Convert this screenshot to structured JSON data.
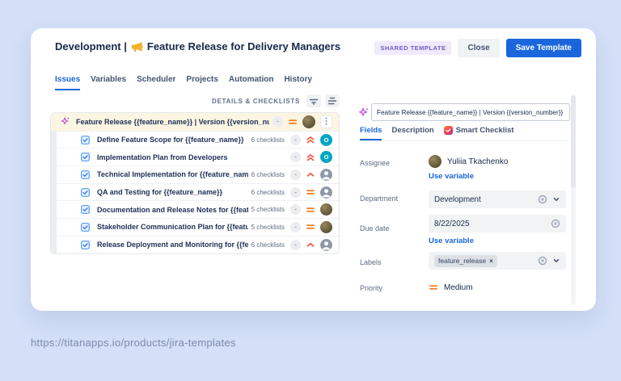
{
  "caption": "https://titanapps.io/products/jira-templates",
  "colors": {
    "background": "#D3E0F8",
    "accent_blue": "#1A66DC",
    "priority_medium_orange": "#F0832B",
    "priority_high_red": "#EF5C48",
    "sparkle_purple": "#BC52DE",
    "avatar_teal": "#00A6C0",
    "parent_row_cream": "#FBF5E2"
  },
  "header": {
    "title_prefix": "Development |",
    "title_main": "Feature Release for Delivery Managers",
    "shared_badge": "SHARED TEMPLATE",
    "close_button": "Close",
    "save_button": "Save Template"
  },
  "nav_tabs": [
    {
      "label": "Issues",
      "active": true
    },
    {
      "label": "Variables",
      "active": false
    },
    {
      "label": "Scheduler",
      "active": false
    },
    {
      "label": "Projects",
      "active": false
    },
    {
      "label": "Automation",
      "active": false
    },
    {
      "label": "History",
      "active": false
    }
  ],
  "left_panel": {
    "header_label": "DETAILS & CHECKLISTS",
    "rows": [
      {
        "type": "parent",
        "title": "Feature Release {{feature_name}} | Version {{version_nu...",
        "checklists": "",
        "estimate": "-",
        "priority": "medium",
        "avatar": "photo",
        "has_menu": true
      },
      {
        "type": "task",
        "title": "Define Feature Scope for {{feature_name}}",
        "checklists": "6 checklists",
        "estimate": "-",
        "priority": "highest",
        "avatar": "O",
        "has_menu": false
      },
      {
        "type": "task",
        "title": "Implementation Plan from Developers",
        "checklists": "",
        "estimate": "-",
        "priority": "highest",
        "avatar": "O",
        "has_menu": false
      },
      {
        "type": "task",
        "title": "Technical Implementation for {{feature_nam...",
        "checklists": "6 checklists",
        "estimate": "-",
        "priority": "high",
        "avatar": "person",
        "has_menu": false
      },
      {
        "type": "task",
        "title": "QA and Testing for {{feature_name}}",
        "checklists": "6 checklists",
        "estimate": "-",
        "priority": "medium",
        "avatar": "person",
        "has_menu": false
      },
      {
        "type": "task",
        "title": "Documentation and Release Notes for {{feat...",
        "checklists": "5 checklists",
        "estimate": "-",
        "priority": "medium",
        "avatar": "photo",
        "has_menu": false
      },
      {
        "type": "task",
        "title": "Stakeholder Communication Plan for {{featu...",
        "checklists": "5 checklists",
        "estimate": "-",
        "priority": "medium",
        "avatar": "photo",
        "has_menu": false
      },
      {
        "type": "task",
        "title": "Release Deployment and Monitoring for {{fe...",
        "checklists": "6 checklists",
        "estimate": "-",
        "priority": "high",
        "avatar": "person",
        "has_menu": false
      }
    ]
  },
  "right_panel": {
    "summary_value": "Feature Release {{feature_name}} | Version {{version_number}}",
    "tabs": [
      {
        "label": "Fields",
        "active": true,
        "icon": ""
      },
      {
        "label": "Description",
        "active": false,
        "icon": ""
      },
      {
        "label": "Smart Checklist",
        "active": false,
        "icon": "smart-checklist-icon"
      }
    ],
    "fields": {
      "assignee": {
        "label": "Assignee",
        "value": "Yuliia Tkachenko",
        "link": "Use variable"
      },
      "department": {
        "label": "Department",
        "value": "Development"
      },
      "due_date": {
        "label": "Due date",
        "value": "8/22/2025",
        "link": "Use variable"
      },
      "labels": {
        "label": "Labels",
        "chip": "feature_release",
        "chip_remove": "×"
      },
      "priority": {
        "label": "Priority",
        "value": "Medium",
        "level": "medium"
      }
    }
  }
}
